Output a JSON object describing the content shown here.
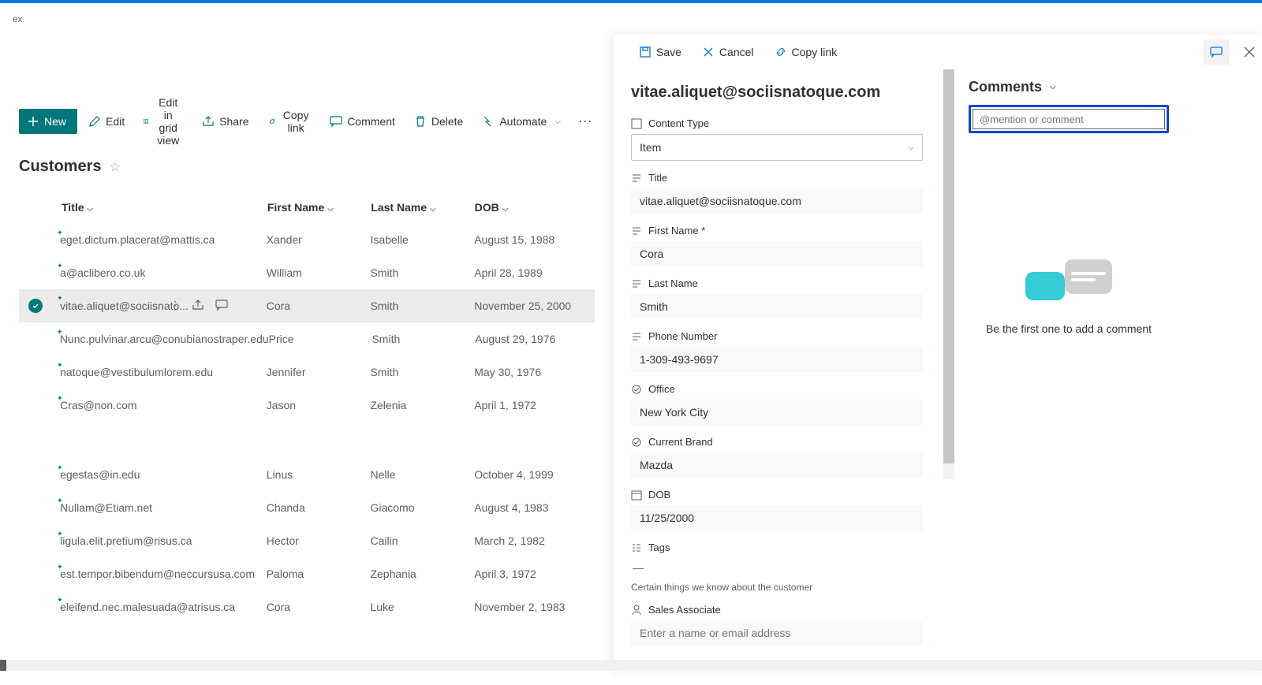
{
  "suite": {
    "tab": "ex"
  },
  "cmdbar": {
    "new": "New",
    "edit": "Edit",
    "editGrid": "Edit in grid view",
    "share": "Share",
    "copylink": "Copy link",
    "comment": "Comment",
    "delete": "Delete",
    "automate": "Automate"
  },
  "list": {
    "title": "Customers",
    "columns": {
      "title": "Title",
      "firstName": "First Name",
      "lastName": "Last Name",
      "dob": "DOB"
    },
    "rows": [
      {
        "title": "eget.dictum.placerat@mattis.ca",
        "firstName": "Xander",
        "lastName": "Isabelle",
        "dob": "August 15, 1988"
      },
      {
        "title": "a@aclibero.co.uk",
        "firstName": "William",
        "lastName": "Smith",
        "dob": "April 28, 1989"
      },
      {
        "title": "vitae.aliquet@sociisnato...",
        "firstName": "Cora",
        "lastName": "Smith",
        "dob": "November 25, 2000",
        "selected": true
      },
      {
        "title": "Nunc.pulvinar.arcu@conubianostraper.edu",
        "firstName": "Price",
        "lastName": "Smith",
        "dob": "August 29, 1976"
      },
      {
        "title": "natoque@vestibulumlorem.edu",
        "firstName": "Jennifer",
        "lastName": "Smith",
        "dob": "May 30, 1976"
      },
      {
        "title": "Cras@non.com",
        "firstName": "Jason",
        "lastName": "Zelenia",
        "dob": "April 1, 1972"
      },
      {
        "title": "egestas@in.edu",
        "firstName": "Linus",
        "lastName": "Nelle",
        "dob": "October 4, 1999"
      },
      {
        "title": "Nullam@Etiam.net",
        "firstName": "Chanda",
        "lastName": "Giacomo",
        "dob": "August 4, 1983"
      },
      {
        "title": "ligula.elit.pretium@risus.ca",
        "firstName": "Hector",
        "lastName": "Cailin",
        "dob": "March 2, 1982"
      },
      {
        "title": "est.tempor.bibendum@neccursusa.com",
        "firstName": "Paloma",
        "lastName": "Zephania",
        "dob": "April 3, 1972"
      },
      {
        "title": "eleifend.nec.malesuada@atrisus.ca",
        "firstName": "Cora",
        "lastName": "Luke",
        "dob": "November 2, 1983"
      }
    ]
  },
  "panel": {
    "save": "Save",
    "cancel": "Cancel",
    "copylink": "Copy link",
    "title": "vitae.aliquet@sociisnatoque.com",
    "fields": {
      "contentType": {
        "label": "Content Type",
        "value": "Item"
      },
      "titleF": {
        "label": "Title",
        "value": "vitae.aliquet@sociisnatoque.com"
      },
      "firstName": {
        "label": "First Name *",
        "value": "Cora"
      },
      "lastName": {
        "label": "Last Name",
        "value": "Smith"
      },
      "phone": {
        "label": "Phone Number",
        "value": "1-309-493-9697"
      },
      "office": {
        "label": "Office",
        "value": "New York City"
      },
      "brand": {
        "label": "Current Brand",
        "value": "Mazda"
      },
      "dob": {
        "label": "DOB",
        "value": "11/25/2000"
      },
      "tags": {
        "label": "Tags",
        "value": "—"
      },
      "tagsDesc": "Certain things we know about the customer",
      "salesAssoc": {
        "label": "Sales Associate",
        "placeholder": "Enter a name or email address"
      }
    }
  },
  "comments": {
    "heading": "Comments",
    "placeholder": "@mention or comment",
    "empty": "Be the first one to add a comment"
  }
}
